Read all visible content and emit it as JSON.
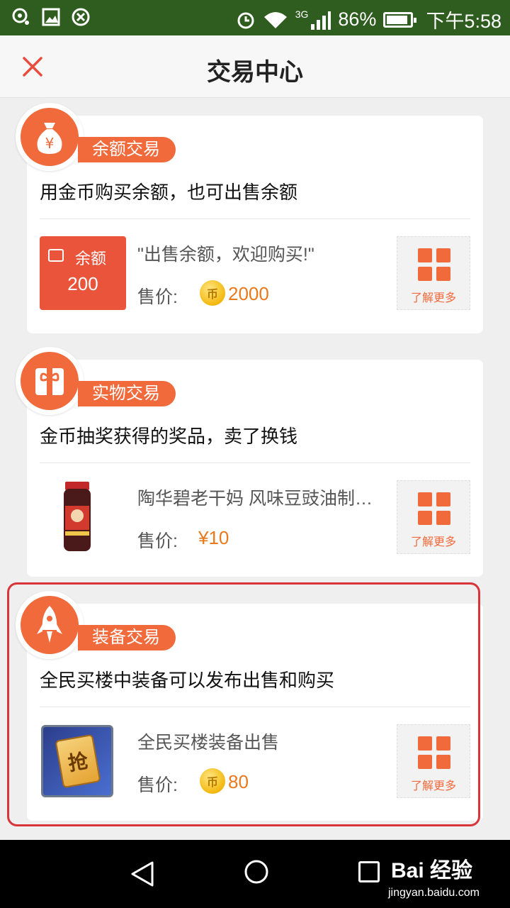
{
  "status_bar": {
    "battery": "86%",
    "time": "下午5:58",
    "network": "3G"
  },
  "header": {
    "title": "交易中心"
  },
  "cards": [
    {
      "tag": "余额交易",
      "desc": "用金币购买余额，也可出售余额",
      "item_name": "\"出售余额，欢迎购买!\"",
      "balance_label": "余额",
      "balance_value": "200",
      "price_label": "售价:",
      "price_value": "2000",
      "more_label": "了解更多"
    },
    {
      "tag": "实物交易",
      "desc": "金币抽奖获得的奖品，卖了换钱",
      "item_name": "陶华碧老干妈 风味豆豉油制辣…",
      "price_label": "售价:",
      "price_value": "¥10",
      "more_label": "了解更多"
    },
    {
      "tag": "装备交易",
      "desc": "全民买楼中装备可以发布出售和购买",
      "item_name": "全民买楼装备出售",
      "equip_char": "抢",
      "price_label": "售价:",
      "price_value": "80",
      "more_label": "了解更多"
    }
  ],
  "coin_char": "币",
  "watermark": {
    "main": "Bai 经验",
    "sub": "jingyan.baidu.com"
  },
  "colors": {
    "accent": "#f06a3c",
    "price": "#e8791d",
    "status_bar": "#2f5d1f",
    "highlight": "#d9343a"
  }
}
